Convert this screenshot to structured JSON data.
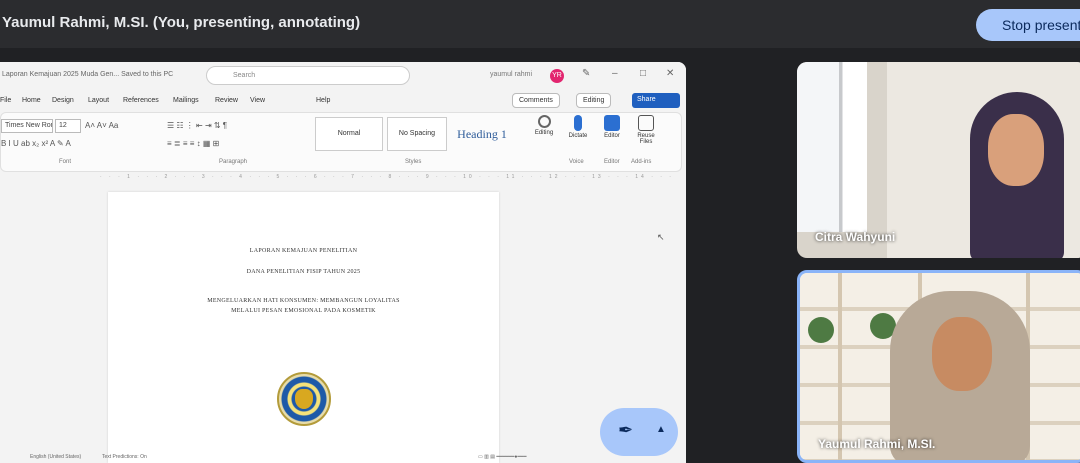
{
  "meeting": {
    "presenter_label": "Yaumul Rahmi, M.SI. (You, presenting, annotating)",
    "stop_button": "Stop presenting"
  },
  "word": {
    "title": "Laporan Kemajuan 2025 Muda Gen... Saved to this PC",
    "search_placeholder": "Search",
    "account": "yaumul rahmi",
    "avatar_initials": "YR",
    "tabs": [
      "File",
      "Home",
      "Design",
      "Layout",
      "References",
      "Mailings",
      "Review",
      "View",
      "Help"
    ],
    "comments_label": "Comments",
    "editing_label": "Editing",
    "share_label": "Share",
    "font_name": "Times New Roman",
    "font_size": "12",
    "styles": [
      "Normal",
      "No Spacing",
      "Heading 1"
    ],
    "groups": [
      "Font",
      "Paragraph",
      "Styles",
      "Voice",
      "Editor",
      "Add-ins"
    ],
    "big_buttons": [
      "Editing",
      "Dictate",
      "Editor",
      "Reuse Files"
    ],
    "status": [
      "English (United States)",
      "Text Predictions: On"
    ],
    "document_lines": [
      "LAPORAN KEMAJUAN PENELITIAN",
      "DANA PENELITIAN FISIP TAHUN 2025",
      "MENGELUARKAN HATI KONSUMEN: MEMBANGUN LOYALITAS",
      "MELALUI PESAN EMOSIONAL PADA KOSMETIK"
    ]
  },
  "participants": [
    {
      "name": "Citra Wahyuni"
    },
    {
      "name": "Yaumul Rahmi, M.SI."
    }
  ],
  "annotation": {
    "pen_icon": "pen-icon",
    "caret_icon": "chevron-up-icon"
  },
  "colors": {
    "accent": "#a8c7fa",
    "share_blue": "#1f5fbf",
    "active_tile_border": "#8ab4f8"
  }
}
